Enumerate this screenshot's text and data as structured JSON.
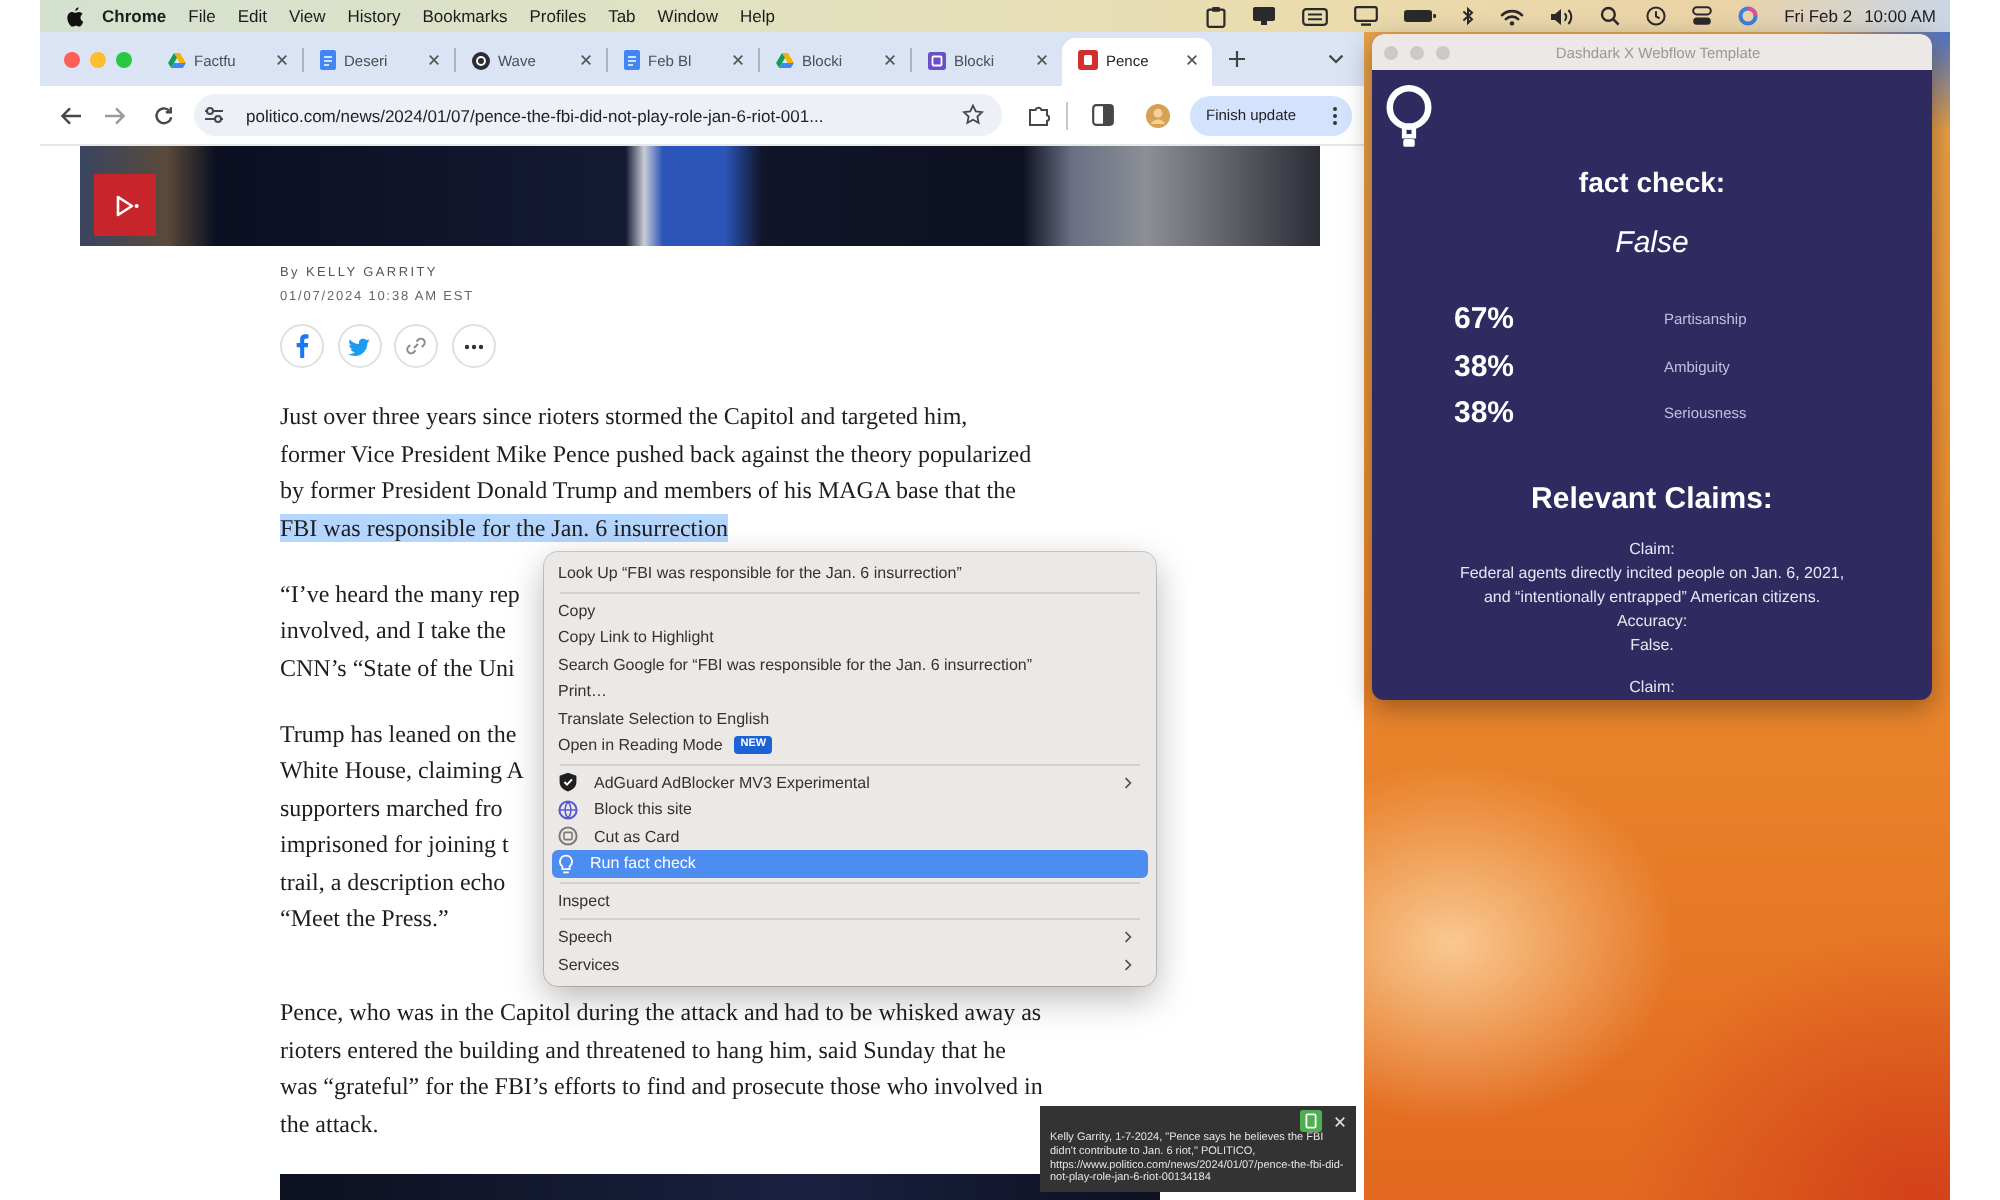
{
  "menu_bar": {
    "app": "Chrome",
    "items": [
      "File",
      "Edit",
      "View",
      "History",
      "Bookmarks",
      "Profiles",
      "Tab",
      "Window",
      "Help"
    ],
    "date": "Fri Feb 2",
    "time": "10:00 AM"
  },
  "browser": {
    "tabs": [
      {
        "title": "Factfu",
        "selected": false
      },
      {
        "title": "Deseri",
        "selected": false
      },
      {
        "title": "Wave",
        "selected": false
      },
      {
        "title": "Feb Bl",
        "selected": false
      },
      {
        "title": "Blocki",
        "selected": false
      },
      {
        "title": "Blocki",
        "selected": false
      },
      {
        "title": "Pence",
        "selected": true
      }
    ],
    "url": "politico.com/news/2024/01/07/pence-the-fbi-did-not-play-role-jan-6-riot-001...",
    "update_button": "Finish update",
    "article": {
      "byline": "By KELLY GARRITY",
      "date": "01/07/2024 10:38 AM EST",
      "paragraphs": [
        {
          "lines": [
            "Just over three years since rioters stormed the Capitol and targeted him,",
            "former Vice President Mike Pence pushed back against the theory popularized",
            "by former President Donald Trump and members of his MAGA base that the"
          ],
          "highlight": "FBI was responsible for the Jan. 6 insurrection"
        },
        {
          "lines": [
            "“I’ve heard the many rep",
            "involved, and I take the",
            "CNN’s “State of the Uni"
          ]
        },
        {
          "lines": [
            "Trump has leaned on the",
            "White House, claiming A",
            "supporters marched fro",
            "imprisoned for joining t",
            "trail, a description echo",
            "“Meet the Press.”"
          ]
        },
        {
          "lines": [
            "Pence, who was in the Capitol during the attack and had to be whisked away as",
            "rioters entered the building and threatened to hang him, said Sunday that he",
            "was “grateful” for the FBI’s efforts to find and prosecute those who involved in",
            "the attack."
          ]
        }
      ]
    }
  },
  "context_menu": {
    "groups": [
      {
        "items": [
          {
            "label": "Look Up “FBI was responsible for the Jan. 6 insurrection”",
            "kind": "command",
            "submenu": false,
            "selected": false
          }
        ]
      },
      {
        "items": [
          {
            "label": "Copy",
            "kind": "command",
            "submenu": false,
            "selected": false
          },
          {
            "label": "Copy Link to Highlight",
            "kind": "command",
            "submenu": false,
            "selected": false
          },
          {
            "label": "Search Google for “FBI was responsible for the Jan. 6 insurrection”",
            "kind": "command",
            "submenu": false,
            "selected": false
          },
          {
            "label": "Print…",
            "kind": "command",
            "submenu": false,
            "selected": false
          },
          {
            "label": "Translate Selection to English",
            "kind": "command",
            "submenu": false,
            "selected": false
          },
          {
            "label": "Open in Reading Mode",
            "kind": "command",
            "submenu": false,
            "selected": false,
            "badge": "NEW"
          }
        ]
      },
      {
        "items": [
          {
            "label": "AdGuard AdBlocker MV3 Experimental",
            "kind": "extension",
            "submenu": true,
            "selected": false
          },
          {
            "label": "Block this site",
            "kind": "extension",
            "submenu": false,
            "selected": false
          },
          {
            "label": "Cut as Card",
            "kind": "extension",
            "submenu": false,
            "selected": false
          },
          {
            "label": "Run fact check",
            "kind": "extension",
            "submenu": false,
            "selected": true
          }
        ]
      },
      {
        "items": [
          {
            "label": "Inspect",
            "kind": "command",
            "submenu": false,
            "selected": false
          }
        ]
      },
      {
        "items": [
          {
            "label": "Speech",
            "kind": "command",
            "submenu": true,
            "selected": false
          },
          {
            "label": "Services",
            "kind": "command",
            "submenu": true,
            "selected": false
          }
        ]
      }
    ]
  },
  "citation_popup": {
    "text": "Kelly Garrity, 1-7-2024, \"Pence says he believes the FBI didn't contribute to Jan. 6 riot,\" POLITICO, https://www.politico.com/news/2024/01/07/pence-the-fbi-did-not-play-role-jan-6-riot-00134184"
  },
  "fact_check_window": {
    "title": "Dashdark X Webflow Template",
    "heading": "fact check:",
    "verdict": "False",
    "scores": [
      {
        "value": "67%",
        "label": "Partisanship"
      },
      {
        "value": "38%",
        "label": "Ambiguity"
      },
      {
        "value": "38%",
        "label": "Seriousness"
      }
    ],
    "claims_heading": "Relevant Claims:",
    "claims": [
      {
        "label": "Claim:",
        "lines": [
          "Federal agents directly incited people on Jan. 6, 2021,",
          "and “intentionally entrapped” American citizens."
        ],
        "accuracy_label": "Accuracy:",
        "accuracy": "False."
      },
      {
        "label": "Claim:"
      }
    ]
  }
}
